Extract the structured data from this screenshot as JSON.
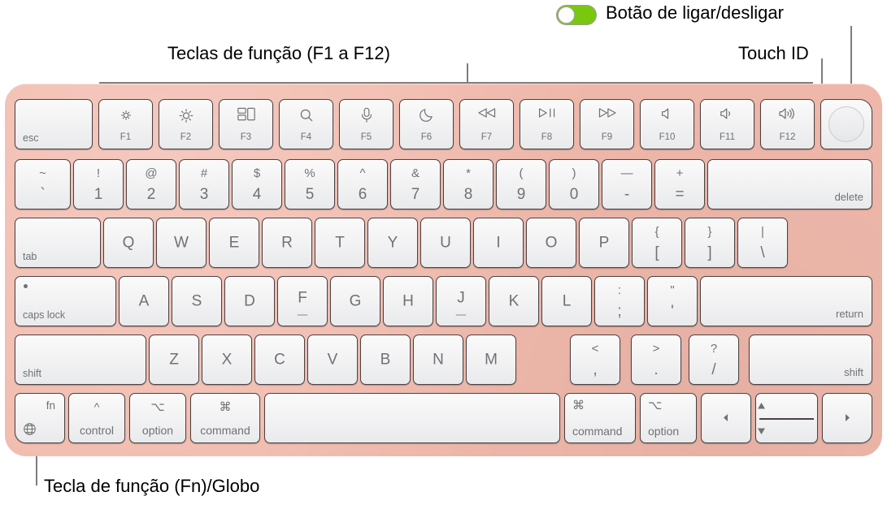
{
  "callouts": {
    "power_button": "Botão de ligar/desligar",
    "function_keys": "Teclas de função (F1 a F12)",
    "touch_id": "Touch ID",
    "fn_globe": "Tecla de função (Fn)/Globo"
  },
  "colors": {
    "body": "#f2baad",
    "key_face": "#f3f3f4",
    "key_border": "#4a4244",
    "legend": "#6f7174",
    "leader_line": "#7d7d7d",
    "toggle_on": "#7ac70f"
  },
  "toggle": {
    "state": "on",
    "icon": "toggle-switch-icon"
  },
  "keyboard": {
    "rows": [
      {
        "name": "function-row",
        "keys": [
          {
            "name": "esc",
            "bl": "esc"
          },
          {
            "name": "f1",
            "icon": "brightness-down-icon",
            "fnum": "F1"
          },
          {
            "name": "f2",
            "icon": "brightness-up-icon",
            "fnum": "F2"
          },
          {
            "name": "f3",
            "icon": "mission-control-icon",
            "fnum": "F3"
          },
          {
            "name": "f4",
            "icon": "spotlight-search-icon",
            "fnum": "F4"
          },
          {
            "name": "f5",
            "icon": "dictation-mic-icon",
            "fnum": "F5"
          },
          {
            "name": "f6",
            "icon": "do-not-disturb-moon-icon",
            "fnum": "F6"
          },
          {
            "name": "f7",
            "icon": "rewind-icon",
            "fnum": "F7"
          },
          {
            "name": "f8",
            "icon": "play-pause-icon",
            "fnum": "F8"
          },
          {
            "name": "f9",
            "icon": "fast-forward-icon",
            "fnum": "F9"
          },
          {
            "name": "f10",
            "icon": "mute-icon",
            "fnum": "F10"
          },
          {
            "name": "f11",
            "icon": "volume-down-icon",
            "fnum": "F11"
          },
          {
            "name": "f12",
            "icon": "volume-up-icon",
            "fnum": "F12"
          },
          {
            "name": "touch-id",
            "icon": "touch-id-icon"
          }
        ]
      },
      {
        "name": "number-row",
        "keys": [
          {
            "name": "grave",
            "up": "~",
            "lo": "`"
          },
          {
            "name": "one",
            "up": "!",
            "lo": "1"
          },
          {
            "name": "two",
            "up": "@",
            "lo": "2"
          },
          {
            "name": "three",
            "up": "#",
            "lo": "3"
          },
          {
            "name": "four",
            "up": "$",
            "lo": "4"
          },
          {
            "name": "five",
            "up": "%",
            "lo": "5"
          },
          {
            "name": "six",
            "up": "^",
            "lo": "6"
          },
          {
            "name": "seven",
            "up": "&",
            "lo": "7"
          },
          {
            "name": "eight",
            "up": "*",
            "lo": "8"
          },
          {
            "name": "nine",
            "up": "(",
            "lo": "9"
          },
          {
            "name": "zero",
            "up": ")",
            "lo": "0"
          },
          {
            "name": "minus",
            "up": "—",
            "lo": "-"
          },
          {
            "name": "equals",
            "up": "+",
            "lo": "="
          },
          {
            "name": "delete",
            "br": "delete"
          }
        ]
      },
      {
        "name": "qwerty-row",
        "keys": [
          {
            "name": "tab",
            "bl": "tab"
          },
          {
            "name": "q",
            "c": "Q"
          },
          {
            "name": "w",
            "c": "W"
          },
          {
            "name": "e",
            "c": "E"
          },
          {
            "name": "r",
            "c": "R"
          },
          {
            "name": "t",
            "c": "T"
          },
          {
            "name": "y",
            "c": "Y"
          },
          {
            "name": "u",
            "c": "U"
          },
          {
            "name": "i",
            "c": "I"
          },
          {
            "name": "o",
            "c": "O"
          },
          {
            "name": "p",
            "c": "P"
          },
          {
            "name": "left-bracket",
            "up": "{",
            "lo": "["
          },
          {
            "name": "right-bracket",
            "up": "}",
            "lo": "]"
          },
          {
            "name": "backslash",
            "up": "|",
            "lo": "\\"
          }
        ]
      },
      {
        "name": "home-row",
        "keys": [
          {
            "name": "caps-lock",
            "bl": "caps lock",
            "dot": true
          },
          {
            "name": "a",
            "c": "A"
          },
          {
            "name": "s",
            "c": "S"
          },
          {
            "name": "d",
            "c": "D"
          },
          {
            "name": "f",
            "c": "F",
            "homing": true
          },
          {
            "name": "g",
            "c": "G"
          },
          {
            "name": "h",
            "c": "H"
          },
          {
            "name": "j",
            "c": "J",
            "homing": true
          },
          {
            "name": "k",
            "c": "K"
          },
          {
            "name": "l",
            "c": "L"
          },
          {
            "name": "semicolon",
            "up": ":",
            "lo": ";"
          },
          {
            "name": "quote",
            "up": "\"",
            "lo": "'"
          },
          {
            "name": "return",
            "br": "return"
          }
        ]
      },
      {
        "name": "shift-row",
        "keys": [
          {
            "name": "shift-left",
            "bl": "shift"
          },
          {
            "name": "z",
            "c": "Z"
          },
          {
            "name": "x",
            "c": "X"
          },
          {
            "name": "c",
            "c": "C"
          },
          {
            "name": "v",
            "c": "V"
          },
          {
            "name": "b",
            "c": "B"
          },
          {
            "name": "n",
            "c": "N"
          },
          {
            "name": "m",
            "c": "M"
          },
          {
            "name": "comma",
            "up": "<",
            "lo": ","
          },
          {
            "name": "period",
            "up": ">",
            "lo": "."
          },
          {
            "name": "slash",
            "up": "?",
            "lo": "/"
          },
          {
            "name": "shift-right",
            "br": "shift"
          }
        ]
      },
      {
        "name": "bottom-row",
        "keys": [
          {
            "name": "fn-globe",
            "tr": "fn",
            "icon": "globe-icon"
          },
          {
            "name": "control-left",
            "up": "^",
            "lo": "control"
          },
          {
            "name": "option-left",
            "up": "⌥",
            "lo": "option"
          },
          {
            "name": "command-left",
            "up": "⌘",
            "lo": "command"
          },
          {
            "name": "space"
          },
          {
            "name": "command-right",
            "tl": "⌘",
            "bl": "command"
          },
          {
            "name": "option-right",
            "tl": "⌥",
            "bl": "option"
          },
          {
            "name": "arrow-left",
            "icon": "arrow-left-icon"
          },
          {
            "name": "arrow-up-down",
            "icon": "arrow-up-down-icon"
          },
          {
            "name": "arrow-right",
            "icon": "arrow-right-icon"
          }
        ]
      }
    ]
  }
}
